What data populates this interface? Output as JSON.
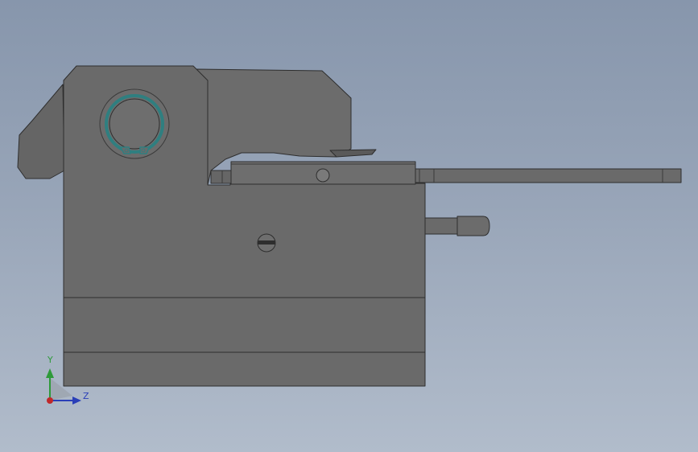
{
  "view": {
    "background_top": "#8796ac",
    "background_bottom": "#b1bccb",
    "part_color": "#6a6a6a",
    "part_edge_color": "#2e2e2e",
    "retaining_ring_color": "#2f7f80"
  },
  "triad": {
    "y_label": "Y",
    "z_label": "Z",
    "y_color": "#2e9a3a",
    "z_color": "#2a3fb8",
    "origin_color": "#c0282a"
  }
}
